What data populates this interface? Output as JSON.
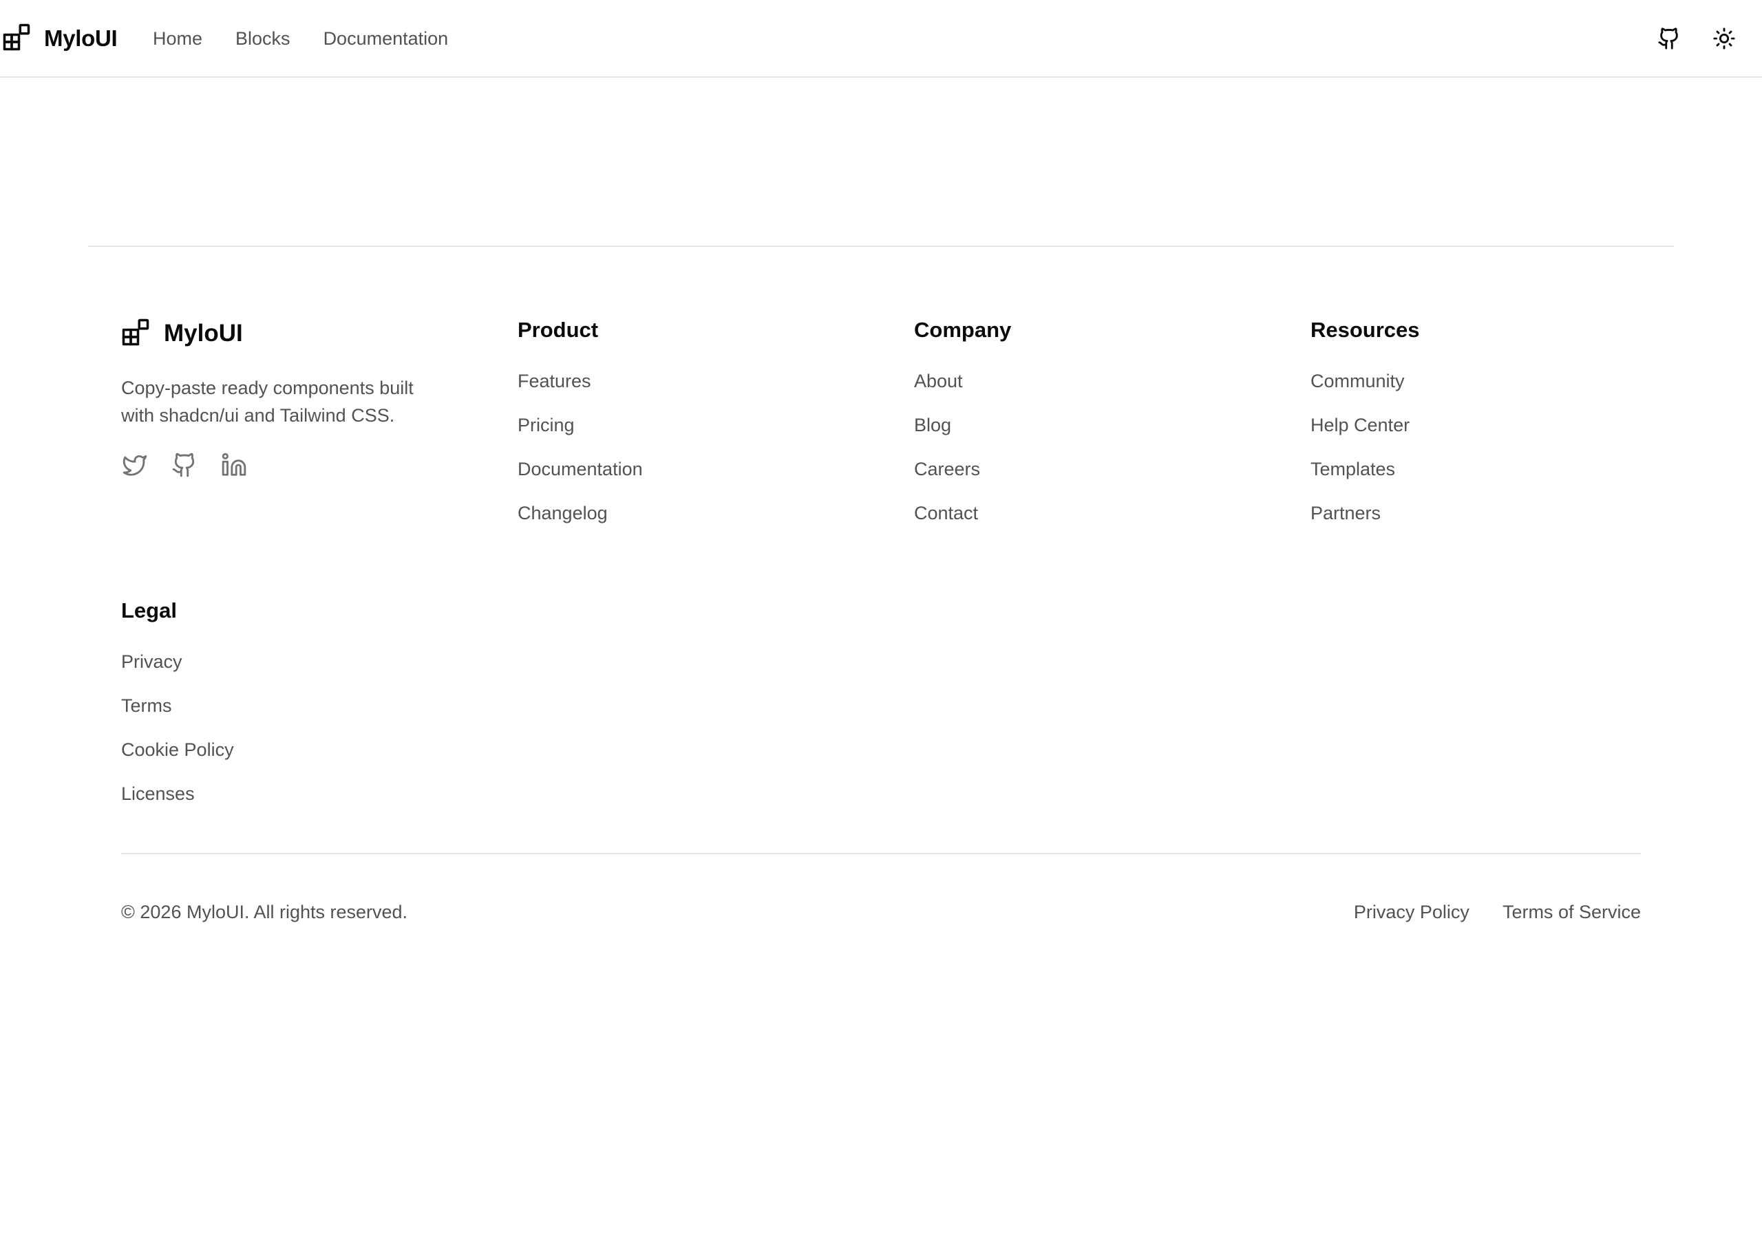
{
  "header": {
    "brand": "MyloUI",
    "nav": [
      "Home",
      "Blocks",
      "Documentation"
    ],
    "icons": [
      "github-icon",
      "sun-icon"
    ]
  },
  "footer": {
    "brand": "MyloUI",
    "description": "Copy-paste ready components built with shadcn/ui and Tailwind CSS.",
    "social_icons": [
      "twitter-icon",
      "github-icon",
      "linkedin-icon"
    ],
    "columns": [
      {
        "title": "Product",
        "links": [
          "Features",
          "Pricing",
          "Documentation",
          "Changelog"
        ]
      },
      {
        "title": "Company",
        "links": [
          "About",
          "Blog",
          "Careers",
          "Contact"
        ]
      },
      {
        "title": "Resources",
        "links": [
          "Community",
          "Help Center",
          "Templates",
          "Partners"
        ]
      },
      {
        "title": "Legal",
        "links": [
          "Privacy",
          "Terms",
          "Cookie Policy",
          "Licenses"
        ]
      }
    ],
    "copyright": "© 2026 MyloUI. All rights reserved.",
    "bottom_links": [
      "Privacy Policy",
      "Terms of Service"
    ]
  },
  "colors": {
    "text": "#0a0a0a",
    "muted": "#525252",
    "border": "#e5e5e5",
    "background": "#ffffff"
  }
}
